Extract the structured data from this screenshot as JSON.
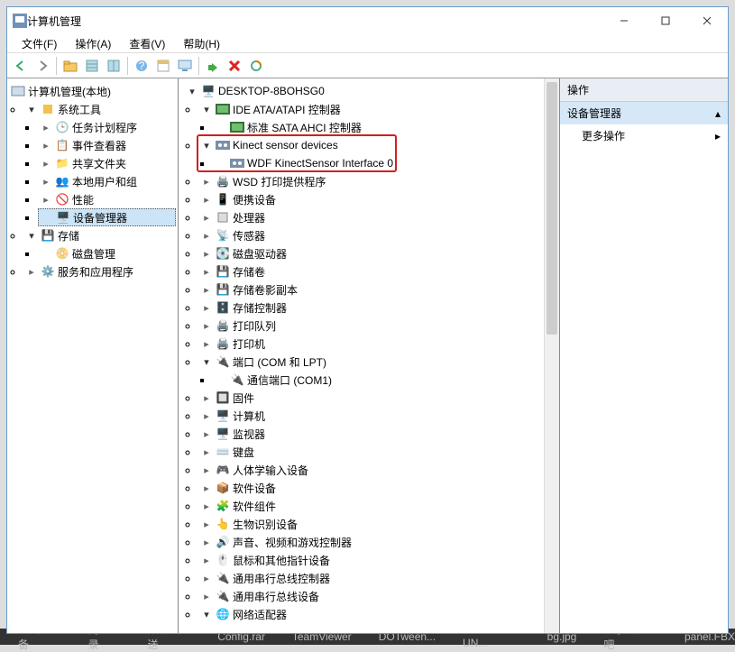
{
  "window": {
    "title": "计算机管理"
  },
  "menus": {
    "file": "文件(F)",
    "action": "操作(A)",
    "view": "查看(V)",
    "help": "帮助(H)"
  },
  "left_tree": {
    "root": "计算机管理(本地)",
    "sys_tools": "系统工具",
    "task_scheduler": "任务计划程序",
    "event_viewer": "事件查看器",
    "shared_folders": "共享文件夹",
    "local_users": "本地用户和组",
    "performance": "性能",
    "device_manager": "设备管理器",
    "storage": "存储",
    "disk_mgmt": "磁盘管理",
    "services_apps": "服务和应用程序"
  },
  "mid_tree": {
    "root": "DESKTOP-8BOHSG0",
    "ide": "IDE ATA/ATAPI 控制器",
    "ide_child": "标准 SATA AHCI 控制器",
    "kinect": "Kinect sensor devices",
    "kinect_child": "WDF KinectSensor Interface 0",
    "wsd": "WSD 打印提供程序",
    "portable": "便携设备",
    "cpu": "处理器",
    "sensors": "传感器",
    "disk_drives": "磁盘驱动器",
    "volumes": "存储卷",
    "shadow": "存储卷影副本",
    "storage_ctrl": "存储控制器",
    "print_queue": "打印队列",
    "printers": "打印机",
    "ports": "端口 (COM 和 LPT)",
    "com1": "通信端口 (COM1)",
    "firmware": "固件",
    "computer": "计算机",
    "monitors": "监视器",
    "keyboards": "键盘",
    "hid": "人体学输入设备",
    "soft_dev": "软件设备",
    "soft_comp": "软件组件",
    "biometric": "生物识别设备",
    "sound": "声音、视频和游戏控制器",
    "mouse": "鼠标和其他指针设备",
    "usb_ctrl": "通用串行总线控制器",
    "usb_dev": "通用串行总线设备",
    "network": "网络适配器"
  },
  "right_pane": {
    "header": "操作",
    "item1": "设备管理器",
    "item2": "更多操作"
  },
  "taskbar": [
    "电脑必备",
    "向口录",
    "数据发送",
    "Config.rar",
    "TeamViewer",
    "DOTween...",
    "Kinect UN...",
    "bg.jpg",
    "数子研究吧",
    "panel.FBX"
  ]
}
